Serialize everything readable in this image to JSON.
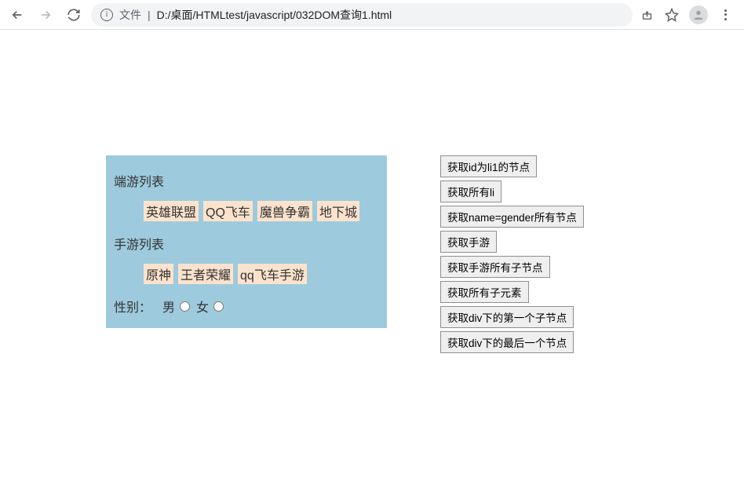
{
  "toolbar": {
    "file_label": "文件",
    "url": "D:/桌面/HTMLtest/javascript/032DOM查询1.html"
  },
  "left": {
    "pc_title": "端游列表",
    "pc_items": [
      "英雄联盟",
      "QQ飞车",
      "魔兽争霸",
      "地下城"
    ],
    "mobile_title": "手游列表",
    "mobile_items": [
      "原神",
      "王者荣耀",
      "qq飞车手游"
    ],
    "gender_label": "性别：",
    "gender_male": "男",
    "gender_female": "女"
  },
  "buttons": [
    "获取id为li1的节点",
    "获取所有li",
    "获取name=gender所有节点",
    "获取手游",
    "获取手游所有子节点",
    "获取所有子元素",
    "获取div下的第一个子节点",
    "获取div下的最后一个节点"
  ]
}
